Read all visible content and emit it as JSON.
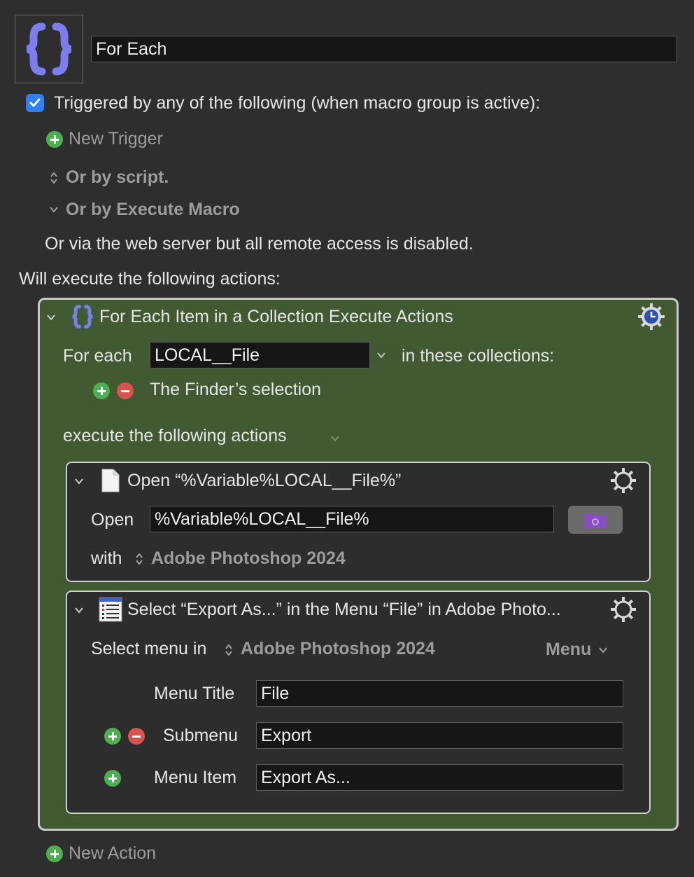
{
  "macro": {
    "name": "For Each",
    "triggered_label": "Triggered by any of the following (when macro group is active):",
    "new_trigger": "New Trigger",
    "or_by_script": "Or by script.",
    "or_by_execute_macro": "Or by Execute Macro",
    "web_server_note": "Or via the web server but all remote access is disabled.",
    "will_execute": "Will execute the following actions:",
    "new_action": "New Action"
  },
  "for_each": {
    "title": "For Each Item in a Collection Execute Actions",
    "for_each_label": "For each",
    "variable": "LOCAL__File",
    "in_collections": "in these collections:",
    "collection": "The Finder’s selection",
    "execute_label": "execute the following actions"
  },
  "open_action": {
    "title": "Open “%Variable%LOCAL__File%”",
    "open_label": "Open",
    "path": "%Variable%LOCAL__File%",
    "with_label": "with",
    "app": "Adobe Photoshop 2024"
  },
  "menu_action": {
    "title": "Select “Export As...” in the Menu “File” in Adobe Photo...",
    "select_menu_label": "Select menu in",
    "app": "Adobe Photoshop 2024",
    "menu_dropdown": "Menu",
    "menu_title_label": "Menu Title",
    "menu_title_value": "File",
    "submenu_label": "Submenu",
    "submenu_value": "Export",
    "menu_item_label": "Menu Item",
    "menu_item_value": "Export As..."
  },
  "colors": {
    "accent_purple": "#7b7ef0",
    "group_green": "#415a32",
    "checkbox_blue": "#2f7ff5"
  }
}
